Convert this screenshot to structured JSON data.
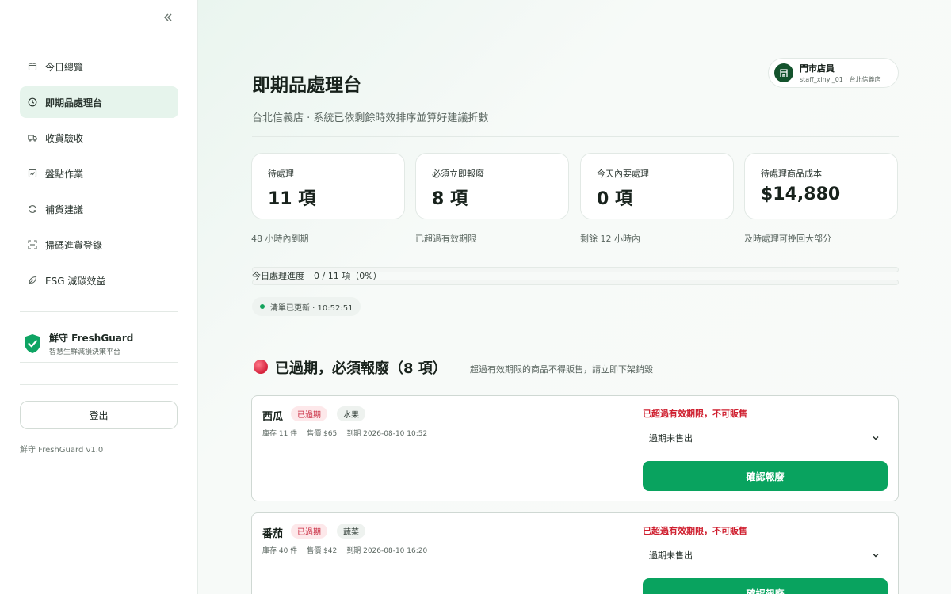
{
  "sidebar": {
    "collapse_icon": "double-chevron-left-icon",
    "items": [
      {
        "label": "今日總覽",
        "icon": "calendar-icon",
        "active": false
      },
      {
        "label": "即期品處理台",
        "icon": "clock-icon",
        "active": true
      },
      {
        "label": "收貨驗收",
        "icon": "truck-icon",
        "active": false
      },
      {
        "label": "盤點作業",
        "icon": "clipboard-icon",
        "active": false
      },
      {
        "label": "補貨建議",
        "icon": "refresh-icon",
        "active": false
      },
      {
        "label": "掃碼進貨登錄",
        "icon": "scan-icon",
        "active": false
      },
      {
        "label": "ESG 減碳效益",
        "icon": "leaf-icon",
        "active": false
      }
    ],
    "brand": {
      "name": "鮮守 FreshGuard",
      "tagline": "智慧生鮮減損決策平台"
    },
    "logout_label": "登出",
    "version": "鮮守 FreshGuard v1.0"
  },
  "header": {
    "title": "即期品處理台",
    "subtitle": "台北信義店 · 系統已依剩餘時效排序並算好建議折數",
    "user": {
      "role": "門市店員",
      "meta": "staff_xinyi_01 · 台北信義店"
    }
  },
  "stats": [
    {
      "label": "待處理",
      "value": "11 項",
      "note": "48 小時內到期"
    },
    {
      "label": "必須立即報廢",
      "value": "8 項",
      "note": "已超過有效期限"
    },
    {
      "label": "今天內要處理",
      "value": "0 項",
      "note": "剩餘 12 小時內"
    },
    {
      "label": "待處理商品成本",
      "value": "$14,880",
      "note": "及時處理可挽回大部分"
    }
  ],
  "progress": {
    "label": "今日處理進度",
    "value_text": "0 / 11 項（0%）",
    "fraction": 0
  },
  "update": {
    "text": "清單已更新 · 10:52:51"
  },
  "section": {
    "title": "已過期，必須報廢（8 項）",
    "description": "超過有效期限的商品不得販售，請立即下架銷毀"
  },
  "items": [
    {
      "name": "西瓜",
      "status_tag": "已過期",
      "category": "水果",
      "stock": "庫存 11 件",
      "price": "售價 $65",
      "expiry": "到期 2026-08-10 10:52",
      "warning": "已超過有效期限，不可販售",
      "reason": "過期未售出",
      "action_label": "確認報廢"
    },
    {
      "name": "番茄",
      "status_tag": "已過期",
      "category": "蔬菜",
      "stock": "庫存 40 件",
      "price": "售價 $42",
      "expiry": "到期 2026-08-10 16:20",
      "warning": "已超過有效期限，不可販售",
      "reason": "過期未售出",
      "action_label": "確認報廢"
    }
  ]
}
